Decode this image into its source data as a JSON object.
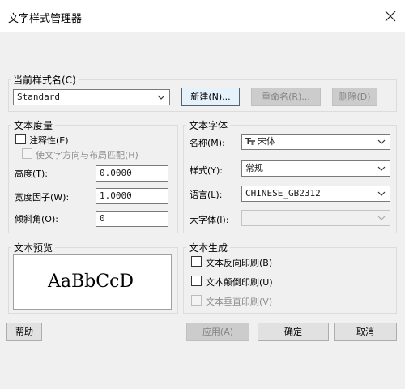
{
  "dialog": {
    "title": "文字样式管理器"
  },
  "current_style": {
    "label": "当前样式名(C)",
    "value": "Standard",
    "new_button": "新建(N)...",
    "rename_button": "重命名(R)...",
    "delete_button": "删除(D)"
  },
  "metrics": {
    "label": "文本度量",
    "annotative_label": "注释性(E)",
    "annotative_checked": false,
    "match_orientation_label": "使文字方向与布局匹配(H)",
    "height_label": "高度(T):",
    "height_value": "0.0000",
    "width_factor_label": "宽度因子(W):",
    "width_factor_value": "1.0000",
    "oblique_label": "倾斜角(O):",
    "oblique_value": "0"
  },
  "font": {
    "label": "文本字体",
    "name_label": "名称(M):",
    "name_value": "宋体",
    "style_label": "样式(Y):",
    "style_value": "常规",
    "language_label": "语言(L):",
    "language_value": "CHINESE_GB2312",
    "bigfont_label": "大字体(I):",
    "bigfont_value": ""
  },
  "preview": {
    "label": "文本预览",
    "sample": "AaBbCcD"
  },
  "effects": {
    "label": "文本生成",
    "backwards_label": "文本反向印刷(B)",
    "backwards_checked": false,
    "upside_down_label": "文本颠倒印刷(U)",
    "upside_down_checked": false,
    "vertical_label": "文本垂直印刷(V)",
    "vertical_checked": false
  },
  "footer": {
    "help": "帮助",
    "apply": "应用(A)",
    "ok": "确定",
    "cancel": "取消"
  }
}
